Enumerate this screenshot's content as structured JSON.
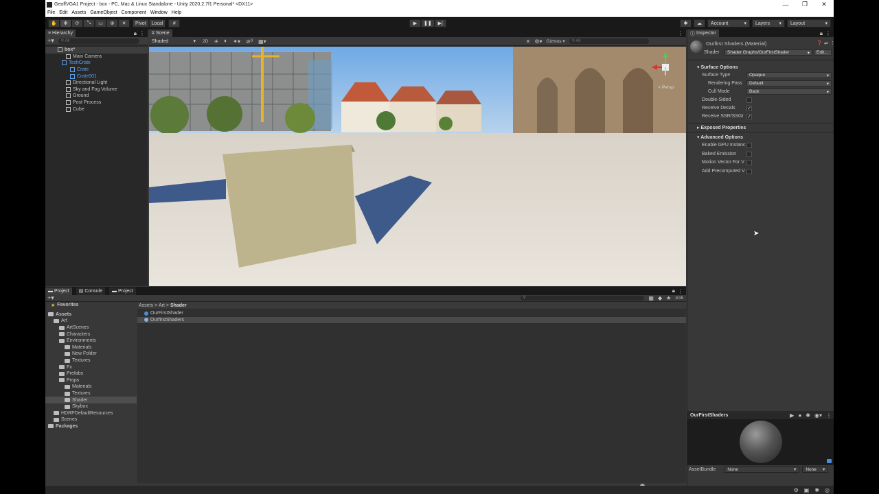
{
  "window": {
    "title": "GeoffVGA1 Project - box - PC, Mac & Linux Standalone - Unity 2020.2.7f1 Personal* <DX11>",
    "menu": [
      "File",
      "Edit",
      "Assets",
      "GameObject",
      "Component",
      "Window",
      "Help"
    ]
  },
  "toolbar": {
    "pivot": "Pivot",
    "local": "Local",
    "account": "Account",
    "layers": "Layers",
    "layout": "Layout"
  },
  "hierarchy": {
    "tab": "Hierarchy",
    "search": "All",
    "items": [
      {
        "label": "box*",
        "indent": 0
      },
      {
        "label": "Main Camera",
        "indent": 2
      },
      {
        "label": "TechCrate",
        "indent": 1,
        "blue": true
      },
      {
        "label": "Crate",
        "indent": 3,
        "blue": true
      },
      {
        "label": "Crate001",
        "indent": 3,
        "blue": true
      },
      {
        "label": "Directional Light",
        "indent": 2
      },
      {
        "label": "Sky and Fog Volume",
        "indent": 2
      },
      {
        "label": "Ground",
        "indent": 2
      },
      {
        "label": "Post Process",
        "indent": 2
      },
      {
        "label": "Cube",
        "indent": 2
      }
    ]
  },
  "scene": {
    "tab": "Scene",
    "shading": "Shaded",
    "mode2d": "2D",
    "layers_count": "0",
    "gizmos": "Gizmos",
    "search": "All",
    "persp": "< Persp"
  },
  "inspector": {
    "tab": "Inspector",
    "material_name": "Ourfirst Shaders (Material)",
    "shader_label": "Shader",
    "shader_value": "Shader Graphs/OurFirstShader",
    "edit": "Edit...",
    "sections": {
      "surface": "Surface Options",
      "exposed": "Exposed Properties",
      "advanced": "Advanced Options"
    },
    "surface_rows": [
      {
        "label": "Surface Type",
        "value": "Opaque"
      },
      {
        "label": "Rendering Pass",
        "value": "Default"
      },
      {
        "label": "Cull Mode",
        "value": "Back"
      }
    ],
    "checks": [
      {
        "label": "Double-Sided",
        "checked": ""
      },
      {
        "label": "Receive Decals",
        "checked": "✓"
      },
      {
        "label": "Receive SSR/SSGI",
        "checked": "✓"
      }
    ],
    "advanced_rows": [
      "Enable GPU Instanc",
      "Baked Emission",
      "Motion Vector For V",
      "Add Precomputed V"
    ],
    "preview_name": "OurFirstShaders",
    "asset_bundle_label": "AssetBundle",
    "asset_bundle_value": "None",
    "asset_bundle_variant": "None"
  },
  "project": {
    "tabs": [
      "Project",
      "Console",
      "Project"
    ],
    "favorites": "Favorites",
    "tree": [
      {
        "label": "Assets",
        "indent": 0,
        "bold": true
      },
      {
        "label": "Art",
        "indent": 1
      },
      {
        "label": "ArtScenes",
        "indent": 2
      },
      {
        "label": "Characters",
        "indent": 2
      },
      {
        "label": "Environments",
        "indent": 2
      },
      {
        "label": "Materials",
        "indent": 3
      },
      {
        "label": "New Folder",
        "indent": 3
      },
      {
        "label": "Textures",
        "indent": 3
      },
      {
        "label": "Fx",
        "indent": 2
      },
      {
        "label": "Prefabs",
        "indent": 2
      },
      {
        "label": "Props",
        "indent": 2
      },
      {
        "label": "Materials",
        "indent": 3
      },
      {
        "label": "Textures",
        "indent": 3
      },
      {
        "label": "Shader",
        "indent": 3,
        "selected": true
      },
      {
        "label": "Skybox",
        "indent": 3
      },
      {
        "label": "HDRPDefaultResources",
        "indent": 1
      },
      {
        "label": "Scenes",
        "indent": 1
      },
      {
        "label": "Packages",
        "indent": 0,
        "bold": true
      }
    ],
    "breadcrumb": [
      "Assets",
      "Art",
      "Shader"
    ],
    "files": [
      "OurFirstShader",
      "OurfirstShaders"
    ],
    "hidden_count": "15"
  }
}
